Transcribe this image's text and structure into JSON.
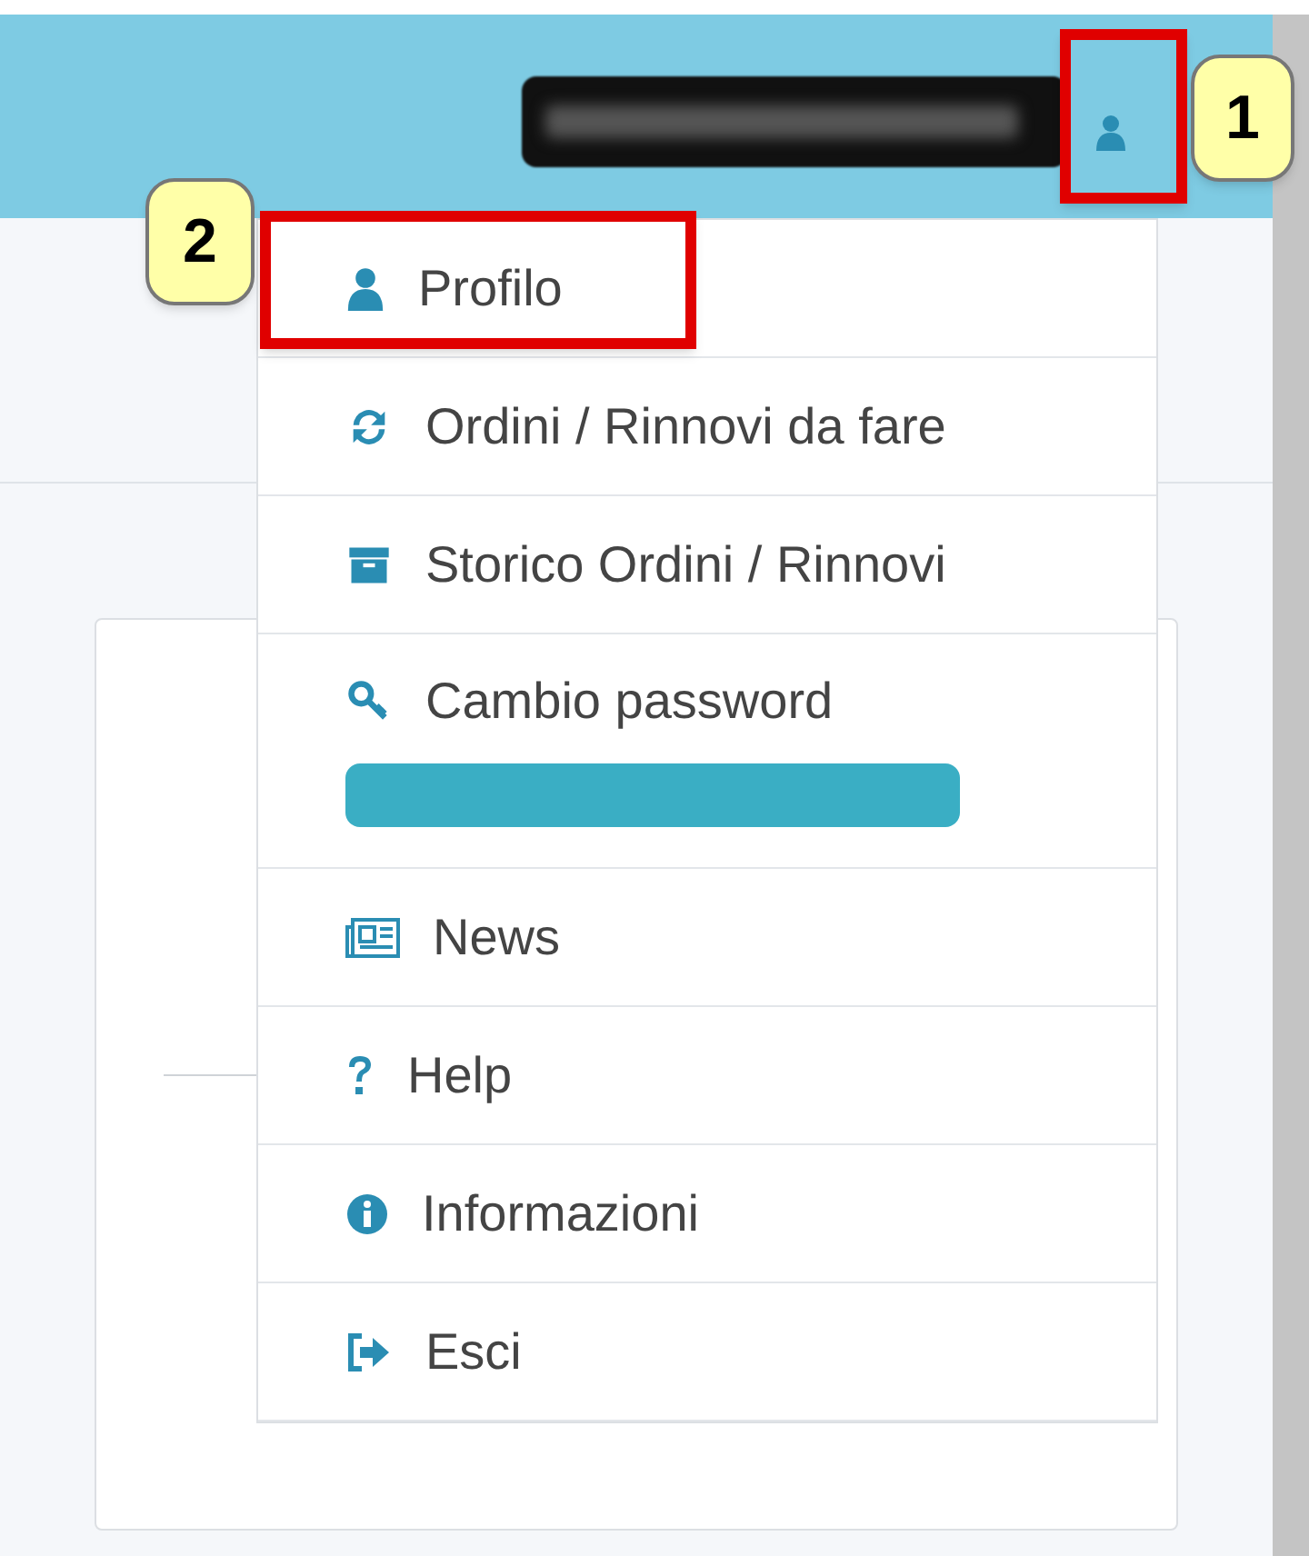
{
  "menu": {
    "items": [
      {
        "label": "Profilo",
        "kind": "plain"
      },
      {
        "label": "Ordini / Rinnovi da fare",
        "kind": "plain"
      },
      {
        "label": "Storico Ordini / Rinnovi",
        "kind": "plain"
      },
      {
        "label": "Cambio password",
        "kind": "with_redacted_bar"
      },
      {
        "label": "News",
        "kind": "plain"
      },
      {
        "label": "Help",
        "kind": "plain"
      },
      {
        "label": "Informazioni",
        "kind": "plain"
      },
      {
        "label": "Esci",
        "kind": "plain"
      }
    ]
  },
  "annotations": [
    {
      "label": "1"
    },
    {
      "label": "2"
    }
  ]
}
